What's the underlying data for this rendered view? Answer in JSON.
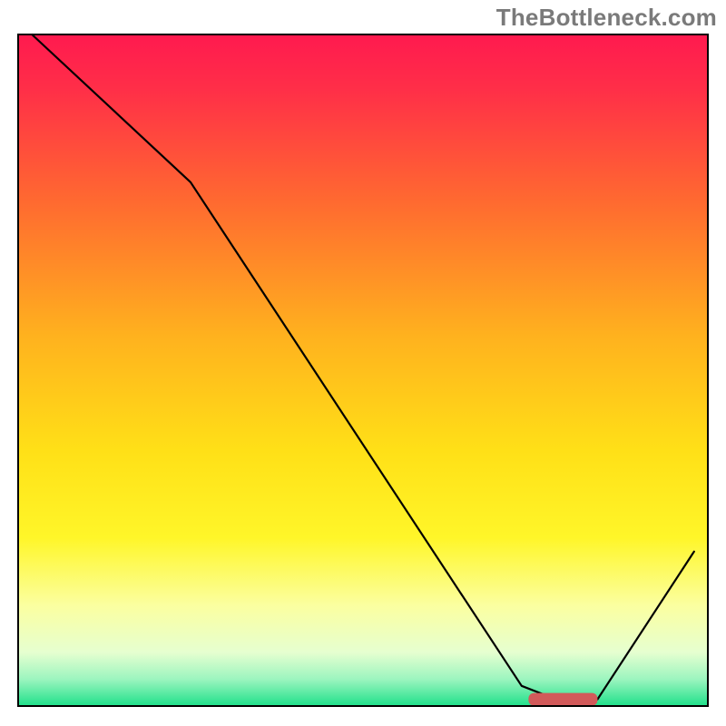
{
  "watermark": "TheBottleneck.com",
  "chart_data": {
    "type": "line",
    "title": "",
    "xlabel": "",
    "ylabel": "",
    "xlim": [
      0,
      100
    ],
    "ylim": [
      0,
      100
    ],
    "curve_points": [
      {
        "x": 2,
        "y": 100
      },
      {
        "x": 25,
        "y": 78
      },
      {
        "x": 73,
        "y": 3
      },
      {
        "x": 78,
        "y": 1
      },
      {
        "x": 84,
        "y": 1
      },
      {
        "x": 98,
        "y": 23
      }
    ],
    "marker": {
      "x_start": 74,
      "x_end": 84,
      "y": 1
    },
    "gradient_stops": [
      {
        "offset": 0.0,
        "color": "#ff1a4f"
      },
      {
        "offset": 0.08,
        "color": "#ff2e48"
      },
      {
        "offset": 0.25,
        "color": "#ff6a30"
      },
      {
        "offset": 0.45,
        "color": "#ffb21e"
      },
      {
        "offset": 0.62,
        "color": "#ffe017"
      },
      {
        "offset": 0.75,
        "color": "#fff629"
      },
      {
        "offset": 0.85,
        "color": "#fbffa0"
      },
      {
        "offset": 0.92,
        "color": "#e6ffd0"
      },
      {
        "offset": 0.96,
        "color": "#9cf5bf"
      },
      {
        "offset": 1.0,
        "color": "#1fe08a"
      }
    ],
    "colors": {
      "curve": "#000000",
      "marker": "#d25a5a",
      "border": "#000000"
    }
  }
}
